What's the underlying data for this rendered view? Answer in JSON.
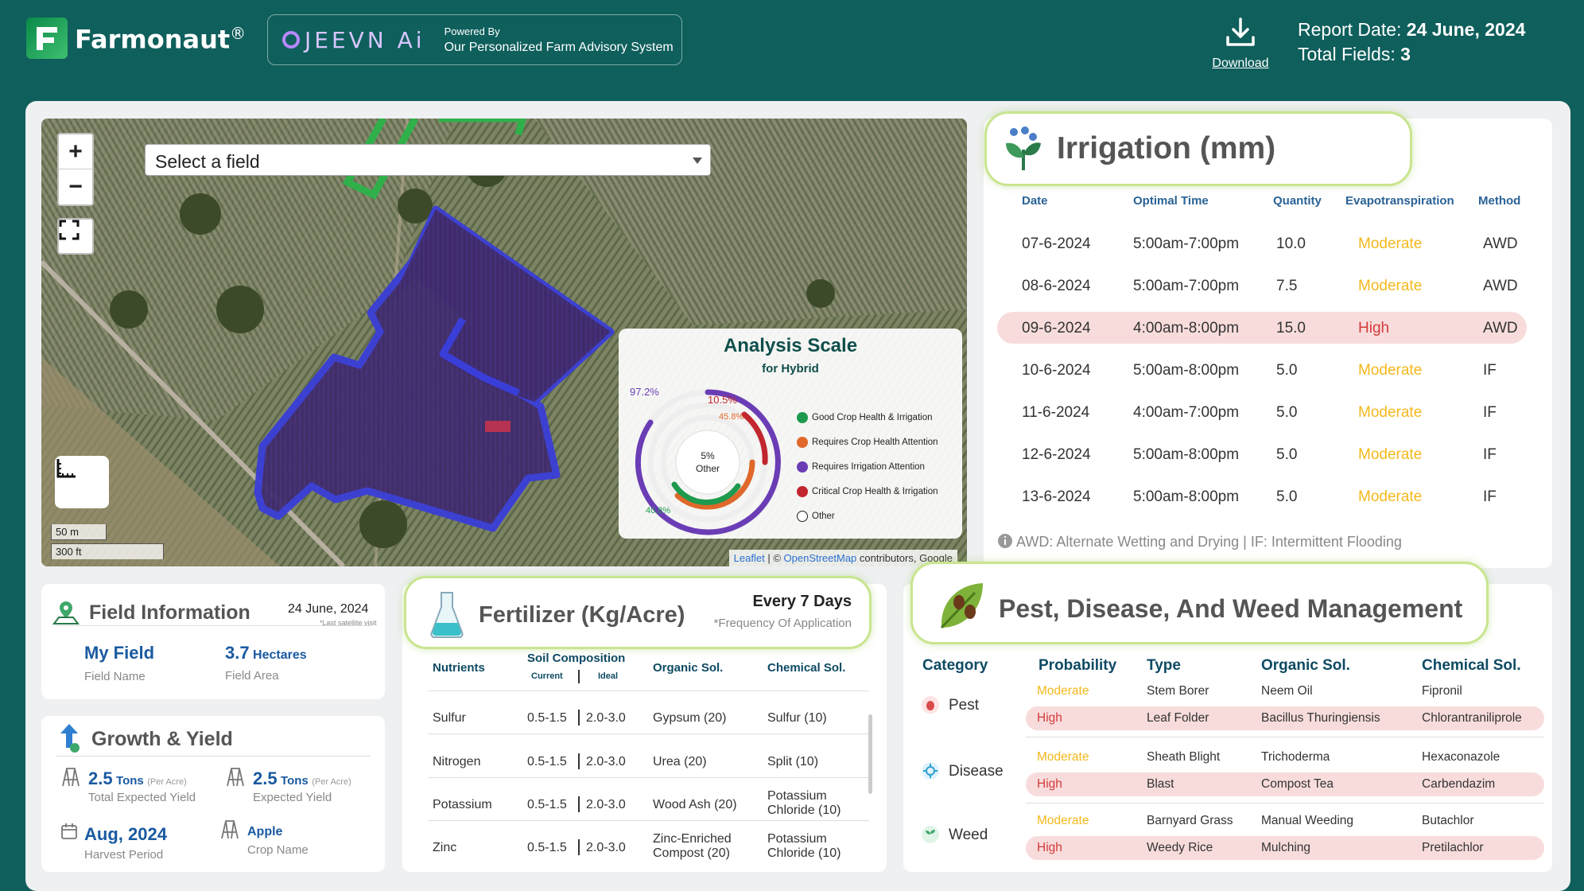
{
  "header": {
    "brand": "Farmonaut",
    "brand_reg": "®",
    "jeevn_logo": "JEEVN Ai",
    "powered_by": "Powered By",
    "powered_desc": "Our Personalized Farm Advisory System",
    "download_label": "Download",
    "report_date_label": "Report Date:",
    "report_date": "24 June, 2024",
    "total_fields_label": "Total Fields:",
    "total_fields": "3"
  },
  "map": {
    "zoom_in": "+",
    "zoom_out": "−",
    "select_placeholder": "Select a field",
    "scale_m": "50 m",
    "scale_ft": "300 ft",
    "attribution_leaflet": "Leaflet",
    "attribution_osm": "OpenStreetMap",
    "attribution_rest": "contributors, Google",
    "analysis": {
      "title": "Analysis Scale",
      "subtitle": "for Hybrid",
      "outer_pct": "97.2%",
      "red_pct": "10.5%",
      "orange_pct": "45.8%",
      "green_pct": "40.8%",
      "center_pct": "5%",
      "center_label": "Other",
      "legend": [
        {
          "label": "Good Crop Health & Irrigation",
          "color": "#1e9a4e"
        },
        {
          "label": "Requires Crop Health Attention",
          "color": "#e0682a"
        },
        {
          "label": "Requires Irrigation Attention",
          "color": "#6a3db5"
        },
        {
          "label": "Critical Crop Health & Irrigation",
          "color": "#c2262e"
        },
        {
          "label": "Other",
          "color": "#ffffff"
        }
      ]
    }
  },
  "irrigation": {
    "title": "Irrigation (mm)",
    "headers": [
      "Date",
      "Optimal Time",
      "Quantity",
      "Evapotranspiration",
      "Method"
    ],
    "rows": [
      {
        "date": "07-6-2024",
        "time": "5:00am-7:00pm",
        "qty": "10.0",
        "evap": "Moderate",
        "method": "AWD",
        "high": false
      },
      {
        "date": "08-6-2024",
        "time": "5:00am-7:00pm",
        "qty": "7.5",
        "evap": "Moderate",
        "method": "AWD",
        "high": false
      },
      {
        "date": "09-6-2024",
        "time": "4:00am-8:00pm",
        "qty": "15.0",
        "evap": "High",
        "method": "AWD",
        "high": true
      },
      {
        "date": "10-6-2024",
        "time": "5:00am-8:00pm",
        "qty": "5.0",
        "evap": "Moderate",
        "method": "IF",
        "high": false
      },
      {
        "date": "11-6-2024",
        "time": "4:00am-7:00pm",
        "qty": "5.0",
        "evap": "Moderate",
        "method": "IF",
        "high": false
      },
      {
        "date": "12-6-2024",
        "time": "5:00am-8:00pm",
        "qty": "5.0",
        "evap": "Moderate",
        "method": "IF",
        "high": false
      },
      {
        "date": "13-6-2024",
        "time": "5:00am-8:00pm",
        "qty": "5.0",
        "evap": "Moderate",
        "method": "IF",
        "high": false
      }
    ],
    "note": "AWD: Alternate Wetting and Drying | IF: Intermittent Flooding"
  },
  "field_info": {
    "title": "Field Information",
    "date": "24 June, 2024",
    "date_note": "*Last satellite visit",
    "field_name": "My Field",
    "field_name_label": "Field Name",
    "area_value": "3.7",
    "area_unit": "Hectares",
    "area_label": "Field Area"
  },
  "growth": {
    "title": "Growth & Yield",
    "total_yield_value": "2.5",
    "total_yield_unit": "Tons",
    "total_yield_per": "(Per Acre)",
    "total_yield_label": "Total Expected Yield",
    "exp_yield_value": "2.5",
    "exp_yield_unit": "Tons",
    "exp_yield_per": "(Per Acre)",
    "exp_yield_label": "Expected Yield",
    "harvest_value": "Aug, 2024",
    "harvest_label": "Harvest Period",
    "crop_value": "Apple",
    "crop_label": "Crop Name"
  },
  "fertilizer": {
    "title": "Fertilizer (Kg/Acre)",
    "frequency": "Every 7 Days",
    "frequency_note": "*Frequency Of Application",
    "headers": {
      "nutrients": "Nutrients",
      "soil": "Soil Composition",
      "current": "Current",
      "ideal": "Ideal",
      "organic": "Organic Sol.",
      "chemical": "Chemical Sol."
    },
    "rows": [
      {
        "nutrient": "Sulfur",
        "current": "0.5-1.5",
        "ideal": "2.0-3.0",
        "organic": "Gypsum (20)",
        "chemical": "Sulfur (10)"
      },
      {
        "nutrient": "Nitrogen",
        "current": "0.5-1.5",
        "ideal": "2.0-3.0",
        "organic": "Urea (20)",
        "chemical": "Split (10)"
      },
      {
        "nutrient": "Potassium",
        "current": "0.5-1.5",
        "ideal": "2.0-3.0",
        "organic": "Wood Ash (20)",
        "chemical": "Potassium Chloride (10)"
      },
      {
        "nutrient": "Zinc",
        "current": "0.5-1.5",
        "ideal": "2.0-3.0",
        "organic": "Zinc-Enriched Compost (20)",
        "chemical": "Potassium Chloride (10)"
      }
    ]
  },
  "pest": {
    "title": "Pest, Disease, And Weed Management",
    "headers": [
      "Category",
      "Probability",
      "Type",
      "Organic Sol.",
      "Chemical Sol."
    ],
    "groups": [
      {
        "category": "Pest",
        "rows": [
          {
            "prob": "Moderate",
            "type": "Stem Borer",
            "organic": "Neem Oil",
            "chemical": "Fipronil"
          },
          {
            "prob": "High",
            "type": "Leaf Folder",
            "organic": "Bacillus Thuringiensis",
            "chemical": "Chlorantraniliprole"
          }
        ]
      },
      {
        "category": "Disease",
        "rows": [
          {
            "prob": "Moderate",
            "type": "Sheath Blight",
            "organic": "Trichoderma",
            "chemical": "Hexaconazole"
          },
          {
            "prob": "High",
            "type": "Blast",
            "organic": "Compost Tea",
            "chemical": "Carbendazim"
          }
        ]
      },
      {
        "category": "Weed",
        "rows": [
          {
            "prob": "Moderate",
            "type": "Barnyard Grass",
            "organic": "Manual Weeding",
            "chemical": "Butachlor"
          },
          {
            "prob": "High",
            "type": "Weedy Rice",
            "organic": "Mulching",
            "chemical": "Pretilachlor"
          }
        ]
      }
    ]
  }
}
